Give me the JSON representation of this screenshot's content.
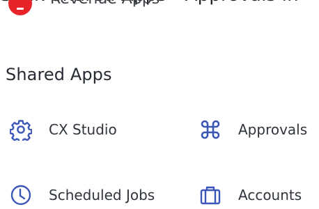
{
  "tooltip": {
    "text": "Stick Shared Apps - Approvals in"
  },
  "previous_app": {
    "label": "Revenue Apps",
    "icon": "red-circle-app-icon",
    "color": "#e8242b"
  },
  "shared_apps": {
    "title": "Shared Apps",
    "accent_color": "#3a57b8",
    "items": [
      {
        "label": "CX Studio",
        "icon": "gear-settings-icon"
      },
      {
        "label": "Approvals",
        "icon": "command-key-icon"
      },
      {
        "label": "Scheduled Jobs",
        "icon": "clock-icon"
      },
      {
        "label": "Accounts",
        "icon": "briefcase-icon"
      }
    ]
  }
}
